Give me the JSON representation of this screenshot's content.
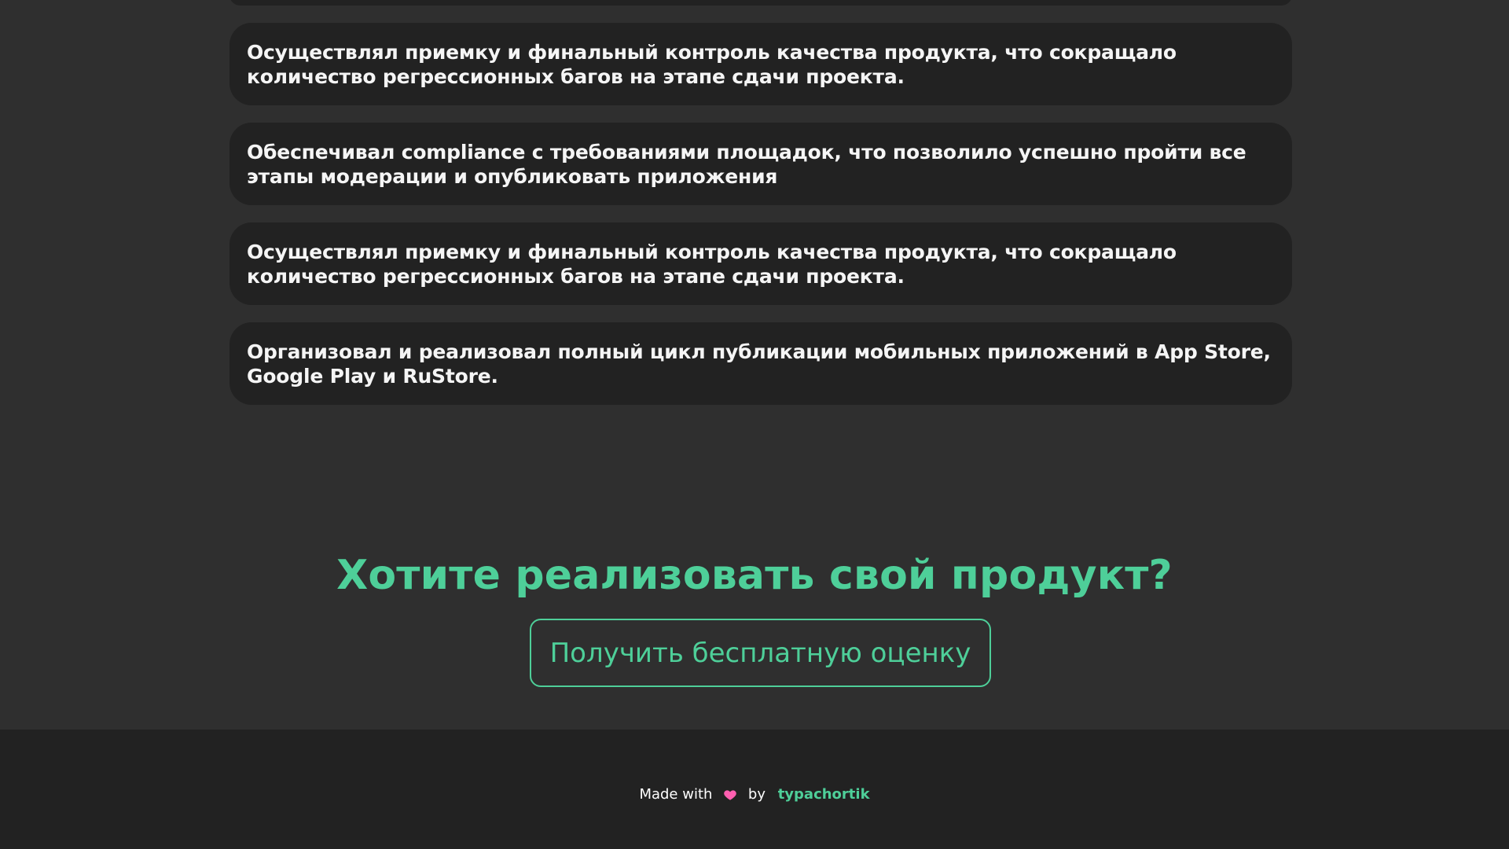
{
  "achievements": {
    "items": [
      {
        "text": ""
      },
      {
        "text": "Осуществлял приемку и финальный контроль качества продукта, что сокращало количество регрессионных багов на этапе сдачи проекта."
      },
      {
        "text": "Обеспечивал compliance с требованиями площадок, что позволило успешно пройти все этапы модерации и опубликовать приложения"
      },
      {
        "text": "Осуществлял приемку и финальный контроль качества продукта, что сокращало количество регрессионных багов на этапе сдачи проекта."
      },
      {
        "text": "Организовал и реализовал полный цикл публикации мобильных приложений в App Store, Google Play и RuStore."
      }
    ]
  },
  "cta": {
    "title": "Хотите реализовать свой продукт?",
    "button_label": "Получить бесплатную оценку"
  },
  "footer": {
    "made_with": "Made with",
    "by": "by",
    "author": "typachortik",
    "heart_icon": "heart-icon",
    "heart_color": "#ff5fb0"
  },
  "colors": {
    "accent": "#4ecf99",
    "page_bg": "#2f2f2f",
    "card_bg": "#222222",
    "footer_bg": "#222222",
    "text": "#f5f5f5"
  }
}
